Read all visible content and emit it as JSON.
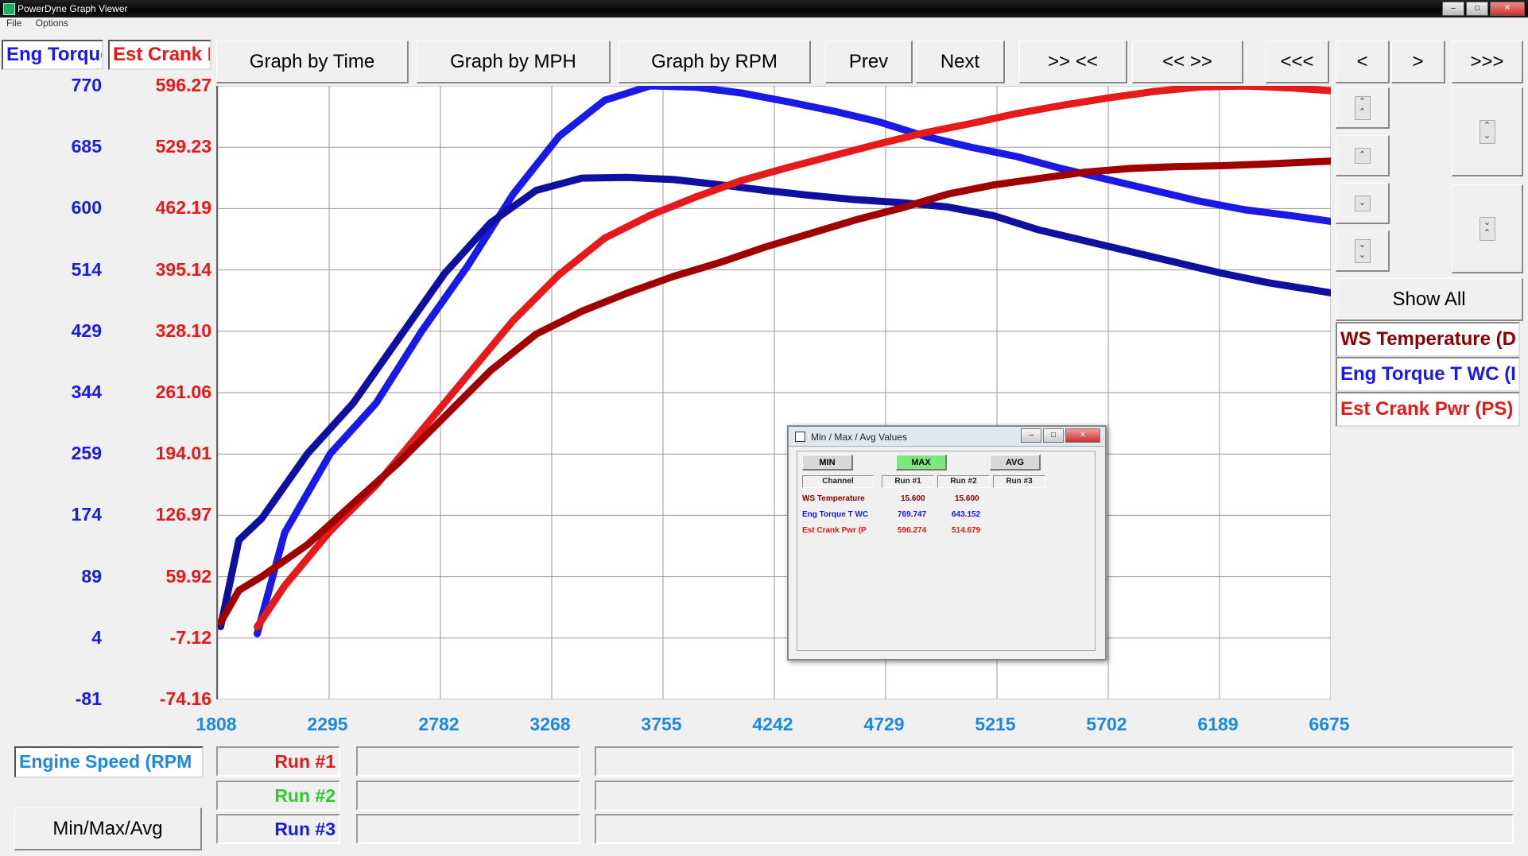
{
  "window": {
    "title": "PowerDyne Graph Viewer",
    "menu": [
      "File",
      "Options"
    ]
  },
  "legend_top": {
    "left": "Eng Torque",
    "right": "Est Crank I"
  },
  "toolbar": {
    "graph_by_time": "Graph by Time",
    "graph_by_mph": "Graph by MPH",
    "graph_by_rpm": "Graph by RPM",
    "prev": "Prev",
    "next": "Next",
    "zoom_in": ">> <<",
    "zoom_out": "<< >>",
    "first": "<<<",
    "back": "<",
    "forward": ">",
    "last": ">>>"
  },
  "left_axis_torque": [
    "770",
    "685",
    "600",
    "514",
    "429",
    "344",
    "259",
    "174",
    "89",
    "4",
    "-81"
  ],
  "left_axis_power": [
    "596.27",
    "529.23",
    "462.19",
    "395.14",
    "328.10",
    "261.06",
    "194.01",
    "126.97",
    "59.92",
    "-7.12",
    "-74.16"
  ],
  "x_axis": [
    "1808",
    "2295",
    "2782",
    "3268",
    "3755",
    "4242",
    "4729",
    "5215",
    "5702",
    "6189",
    "6675"
  ],
  "x_axis_label": "Engine Speed (RPM",
  "side": {
    "show_all": "Show All",
    "channels": [
      {
        "label": "WS Temperature (D",
        "color": "#8b0000"
      },
      {
        "label": "Eng Torque T WC (I",
        "color": "#1a1ae6"
      },
      {
        "label": "Est Crank Pwr (PS)",
        "color": "#e61a1a"
      }
    ]
  },
  "runs": [
    {
      "label": "Run #1",
      "color": "#e61a1a"
    },
    {
      "label": "Run #2",
      "color": "#2ecc2e"
    },
    {
      "label": "Run #3",
      "color": "#1a1ae6"
    }
  ],
  "minmax_button": "Min/Max/Avg",
  "dialog": {
    "title": "Min / Max / Avg Values",
    "tabs": [
      "MIN",
      "MAX",
      "AVG"
    ],
    "headers": [
      "Channel",
      "Run #1",
      "Run #2",
      "Run #3"
    ],
    "rows": [
      {
        "channel": "WS Temperature",
        "run1": "15.600",
        "run2": "15.600",
        "color": "#8b0000"
      },
      {
        "channel": "Eng Torque T WC",
        "run1": "769.747",
        "run2": "643.152",
        "color": "#1a1ae6"
      },
      {
        "channel": "Est Crank Pwr (P",
        "run1": "596.274",
        "run2": "514.679",
        "color": "#e61a1a"
      }
    ]
  },
  "chart_data": {
    "type": "line",
    "xlim": [
      1808,
      6675
    ],
    "ylim_torque": [
      -81,
      770
    ],
    "ylim_power": [
      -74.16,
      596.27
    ],
    "grid": true,
    "series": [
      {
        "name": "Eng Torque T WC",
        "run": "Run #1",
        "axis": "torque",
        "color": "#1a1ae6",
        "x": [
          1980,
          2100,
          2300,
          2500,
          2700,
          2900,
          3100,
          3300,
          3500,
          3700,
          3900,
          4100,
          4300,
          4500,
          4700,
          4900,
          5100,
          5300,
          5500,
          5700,
          5900,
          6100,
          6300,
          6500,
          6675
        ],
        "y": [
          10,
          150,
          260,
          330,
          430,
          520,
          620,
          700,
          750,
          770,
          768,
          760,
          748,
          735,
          720,
          700,
          685,
          672,
          655,
          640,
          625,
          610,
          598,
          590,
          582
        ]
      },
      {
        "name": "Eng Torque T WC",
        "run": "Run #2",
        "axis": "torque",
        "color": "#1010a0",
        "x": [
          1820,
          1900,
          2000,
          2200,
          2400,
          2600,
          2800,
          3000,
          3200,
          3400,
          3600,
          3800,
          4000,
          4200,
          4400,
          4600,
          4800,
          5000,
          5200,
          5400,
          5600,
          5800,
          6000,
          6200,
          6400,
          6675
        ],
        "y": [
          20,
          140,
          170,
          260,
          330,
          420,
          510,
          580,
          625,
          642,
          643,
          640,
          633,
          625,
          618,
          612,
          608,
          602,
          590,
          570,
          555,
          540,
          525,
          510,
          497,
          483
        ]
      },
      {
        "name": "Est Crank Pwr",
        "run": "Run #1",
        "axis": "power",
        "color": "#e61a1a",
        "x": [
          1980,
          2100,
          2300,
          2500,
          2700,
          2900,
          3100,
          3300,
          3500,
          3700,
          3900,
          4100,
          4300,
          4500,
          4700,
          4900,
          5100,
          5300,
          5500,
          5700,
          5900,
          6100,
          6300,
          6500,
          6675
        ],
        "y": [
          5,
          50,
          110,
          160,
          220,
          280,
          340,
          390,
          430,
          455,
          475,
          493,
          507,
          520,
          533,
          545,
          555,
          566,
          575,
          583,
          590,
          595,
          596,
          594,
          591
        ]
      },
      {
        "name": "Est Crank Pwr",
        "run": "Run #2",
        "axis": "power",
        "color": "#a00000",
        "x": [
          1820,
          1900,
          2000,
          2200,
          2400,
          2600,
          2800,
          3000,
          3200,
          3400,
          3600,
          3800,
          4000,
          4200,
          4400,
          4600,
          4800,
          5000,
          5200,
          5400,
          5600,
          5800,
          6000,
          6200,
          6400,
          6675
        ],
        "y": [
          10,
          45,
          60,
          95,
          140,
          185,
          235,
          285,
          325,
          350,
          370,
          388,
          403,
          420,
          435,
          450,
          463,
          478,
          488,
          495,
          502,
          506,
          508,
          509,
          511,
          514
        ]
      }
    ]
  }
}
